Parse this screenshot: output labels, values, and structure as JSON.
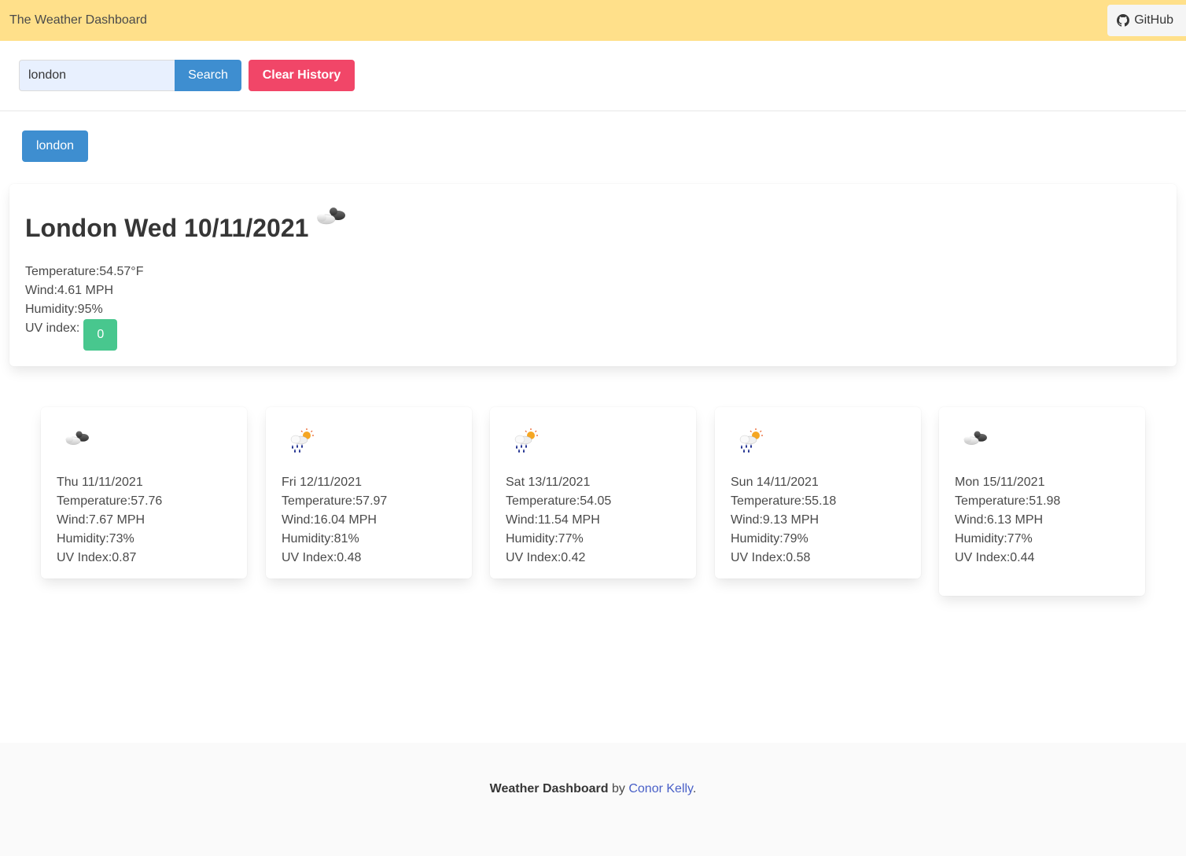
{
  "navbar": {
    "brand": "The Weather Dashboard",
    "github_label": "GitHub"
  },
  "search": {
    "value": "london",
    "button_label": "Search",
    "clear_label": "Clear History"
  },
  "history": [
    "london"
  ],
  "current": {
    "title": "London Wed 10/11/2021",
    "icon": "cloudy-icon",
    "temperature": "Temperature:54.57°F",
    "wind": "Wind:4.61 MPH",
    "humidity": "Humidity:95%",
    "uv_label": "UV index:",
    "uv_value": "0",
    "uv_color": "#48c78e"
  },
  "forecast": [
    {
      "icon": "cloudy-icon",
      "date": "Thu 11/11/2021",
      "temperature": "Temperature:57.76",
      "wind": "Wind:7.67 MPH",
      "humidity": "Humidity:73%",
      "uv": "UV Index:0.87"
    },
    {
      "icon": "rain-sun-icon",
      "date": "Fri 12/11/2021",
      "temperature": "Temperature:57.97",
      "wind": "Wind:16.04 MPH",
      "humidity": "Humidity:81%",
      "uv": "UV Index:0.48"
    },
    {
      "icon": "rain-sun-icon",
      "date": "Sat 13/11/2021",
      "temperature": "Temperature:54.05",
      "wind": "Wind:11.54 MPH",
      "humidity": "Humidity:77%",
      "uv": "UV Index:0.42"
    },
    {
      "icon": "rain-sun-icon",
      "date": "Sun 14/11/2021",
      "temperature": "Temperature:55.18",
      "wind": "Wind:9.13 MPH",
      "humidity": "Humidity:79%",
      "uv": "UV Index:0.58"
    },
    {
      "icon": "cloudy-icon",
      "date": "Mon 15/11/2021",
      "temperature": "Temperature:51.98",
      "wind": "Wind:6.13 MPH",
      "humidity": "Humidity:77%",
      "uv": "UV Index:0.44"
    }
  ],
  "footer": {
    "app_name": "Weather Dashboard",
    "by": "by",
    "author": "Conor Kelly",
    "period": "."
  },
  "colors": {
    "navbar": "#ffe08a",
    "primary": "#3e8ed0",
    "danger": "#f14668",
    "success": "#48c78e",
    "link": "#485fc7"
  }
}
